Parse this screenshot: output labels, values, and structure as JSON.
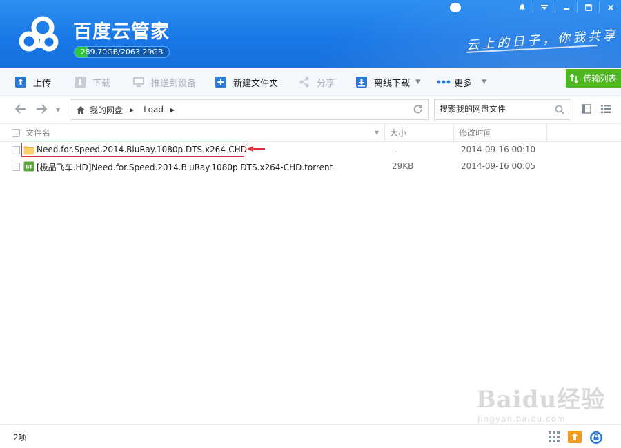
{
  "app": {
    "title": "百度云管家",
    "quota_text": "289.70GB/2063.29GB",
    "quota_fraction": 0.14,
    "slogan": "云上的日子，你我共享"
  },
  "window_controls": [
    "skin",
    "notify",
    "menu",
    "minimize",
    "maximize",
    "close"
  ],
  "toolbar": {
    "upload": "上传",
    "download": "下载",
    "push": "推送到设备",
    "new_folder": "新建文件夹",
    "share": "分享",
    "offline": "离线下载",
    "more": "更多",
    "transfer": "传输列表"
  },
  "breadcrumb": {
    "home": "我的网盘",
    "current": "Load"
  },
  "search": {
    "placeholder": "搜索我的网盘文件"
  },
  "columns": {
    "name": "文件名",
    "size": "大小",
    "modified": "修改时间"
  },
  "files": [
    {
      "name": "Need.for.Speed.2014.BluRay.1080p.DTS.x264-CHD",
      "size": "-",
      "modified": "2014-09-16 00:10",
      "type": "folder"
    },
    {
      "name": "[极品飞车.HD]Need.for.Speed.2014.BluRay.1080p.DTS.x264-CHD.torrent",
      "size": "29KB",
      "modified": "2014-09-16 00:05",
      "type": "bt"
    }
  ],
  "footer": {
    "count": "2项"
  },
  "watermark": {
    "main": "Baidu经验",
    "sub": "jingyan.baidu.com"
  },
  "colors": {
    "header_blue": "#1877e6",
    "quota_green": "#2bc93b",
    "transfer_green": "#4eb523",
    "highlight_red": "#e0303a"
  }
}
